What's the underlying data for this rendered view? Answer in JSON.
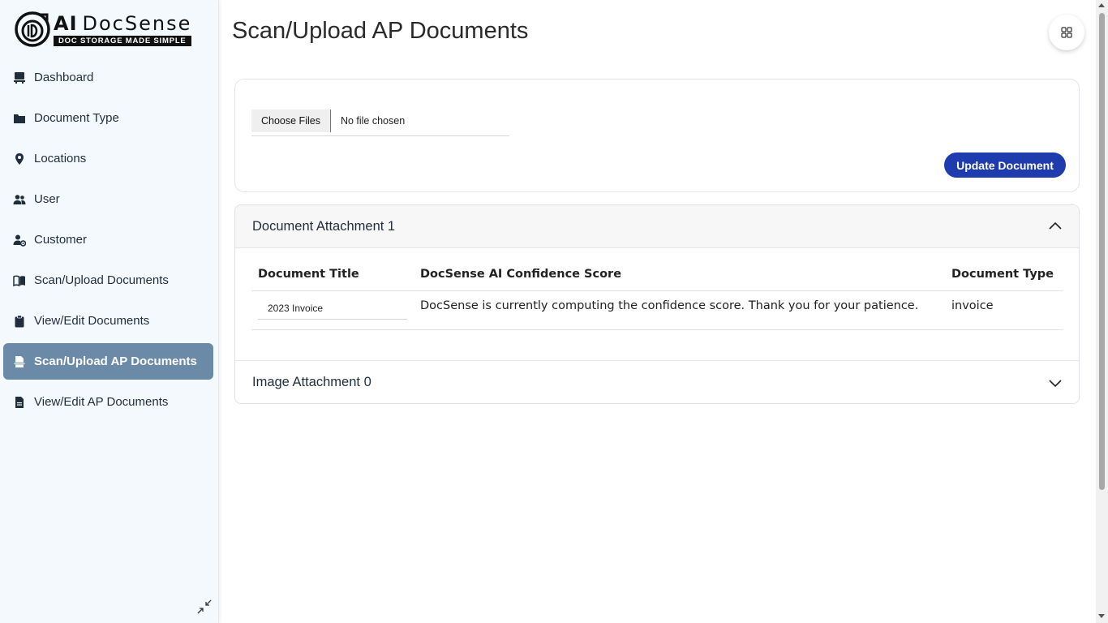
{
  "sidebar": {
    "logo": {
      "ai": "AI",
      "brand": "DocSense",
      "tagline": "DOC STORAGE MADE SIMPLE"
    },
    "items": [
      {
        "label": "Dashboard",
        "icon": "dashboard-icon"
      },
      {
        "label": "Document Type",
        "icon": "folder-icon"
      },
      {
        "label": "Locations",
        "icon": "location-pin-icon"
      },
      {
        "label": "User",
        "icon": "users-icon"
      },
      {
        "label": "Customer",
        "icon": "user-gear-icon"
      },
      {
        "label": "Scan/Upload Documents",
        "icon": "book-open-icon"
      },
      {
        "label": "View/Edit Documents",
        "icon": "clipboard-icon"
      },
      {
        "label": "Scan/Upload AP Documents",
        "icon": "document-upload-icon",
        "active": true
      },
      {
        "label": "View/Edit AP Documents",
        "icon": "document-icon"
      }
    ]
  },
  "header": {
    "title": "Scan/Upload AP Documents"
  },
  "upload": {
    "choose_label": "Choose Files",
    "file_status": "No file chosen",
    "update_label": "Update Document"
  },
  "document_attachment": {
    "header": "Document Attachment 1",
    "columns": [
      "Document Title",
      "DocSense AI Confidence Score",
      "Document Type"
    ],
    "rows": [
      {
        "title": "2023 Invoice",
        "score": "DocSense is currently computing the confidence score. Thank you for your patience.",
        "type": "invoice"
      }
    ]
  },
  "image_attachment": {
    "header": "Image Attachment 0"
  },
  "colors": {
    "active_nav": "#6b8aa8",
    "primary_button": "#1f3caf",
    "sidebar_bg": "#f4f9fd"
  }
}
